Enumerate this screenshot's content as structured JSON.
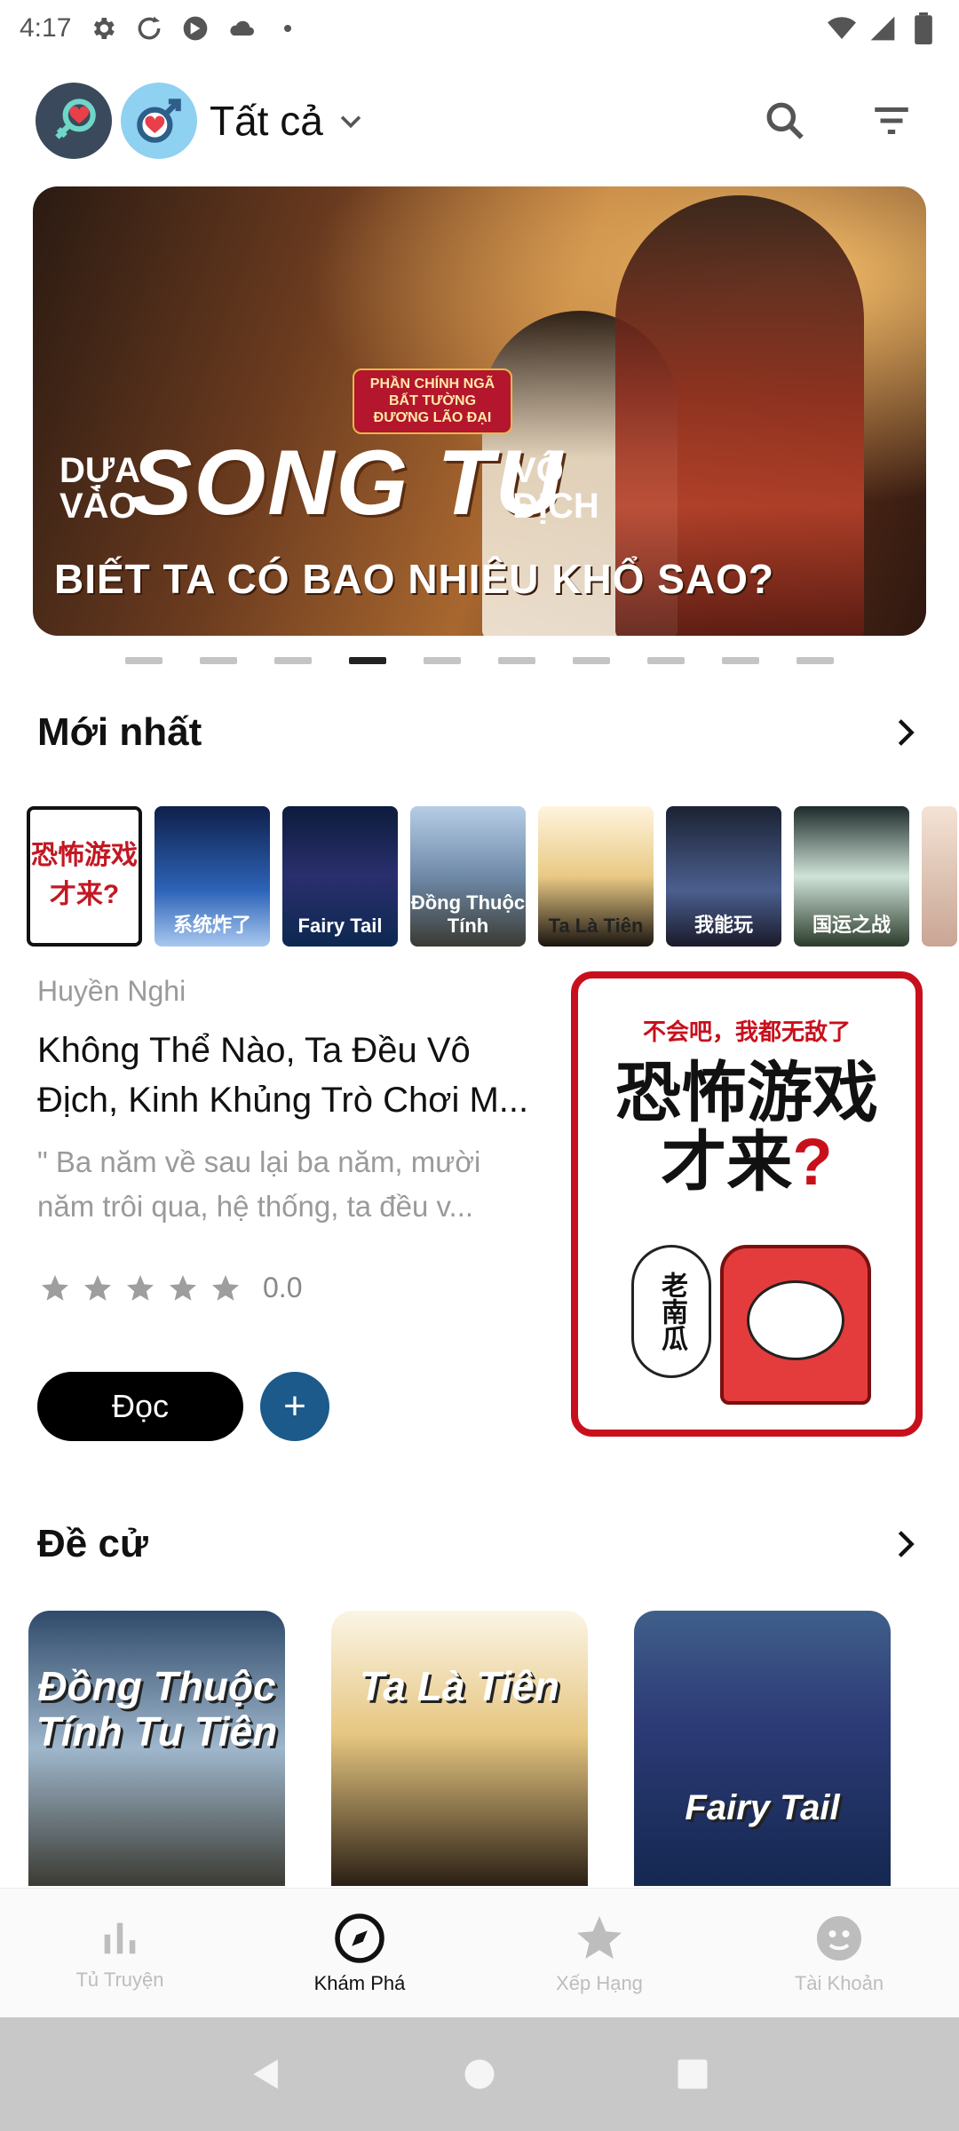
{
  "status_bar": {
    "time": "4:17"
  },
  "header": {
    "filter_label": "Tất cả"
  },
  "banner": {
    "tagline": "PHẦN CHÍNH NGÃ BẤT TƯỜNG ĐƯƠNG LÃO ĐẠI",
    "line_left": "DỰA VÀO",
    "line_main": "SONG TU",
    "line_right": "VÔ ĐỊCH",
    "line_bottom": "BIẾT TA CÓ BAO NHIÊU KHỔ SAO?",
    "dots_total": 10,
    "dots_active_index": 3
  },
  "latest": {
    "title": "Mới nhất",
    "thumbs": [
      "恐怖游戏才来?",
      "系统炸了",
      "Fairy Tail",
      "Đồng Thuộc Tính",
      "Ta Là Tiên",
      "我能玩",
      "国运之战",
      ""
    ],
    "featured": {
      "author": "Huyền Nghi",
      "title": "Không Thể Nào, Ta Đều Vô Địch, Kinh Khủng Trò Chơi M...",
      "description": "\" Ba năm về sau lại ba năm, mười năm trôi qua, hệ thống, ta đều v...",
      "rating": "0.0",
      "read_label": "Đọc",
      "add_label": "+",
      "cover_top": "不会吧，我都无敌了",
      "cover_title_a": "恐怖游戏",
      "cover_title_b": "才来",
      "cover_title_q": "?",
      "cover_sign": "老南瓜"
    }
  },
  "recommended": {
    "title": "Đề cử",
    "cards": [
      {
        "title": "Đồng Thuộc Tính Tu Tiên"
      },
      {
        "title": "Ta Là Tiên"
      },
      {
        "title": "Fairy Tail"
      }
    ]
  },
  "bottom_nav": {
    "items": [
      {
        "label": "Tủ Truyện",
        "icon": "bar-chart-icon"
      },
      {
        "label": "Khám Phá",
        "icon": "compass-icon"
      },
      {
        "label": "Xếp Hạng",
        "icon": "star-icon"
      },
      {
        "label": "Tài Khoản",
        "icon": "account-icon"
      }
    ],
    "active_index": 1
  },
  "colors": {
    "accent_dark": "#000000",
    "add_button": "#1b5a8a",
    "cover_border": "#c8101c",
    "nav_inactive": "#bdbdbd"
  }
}
